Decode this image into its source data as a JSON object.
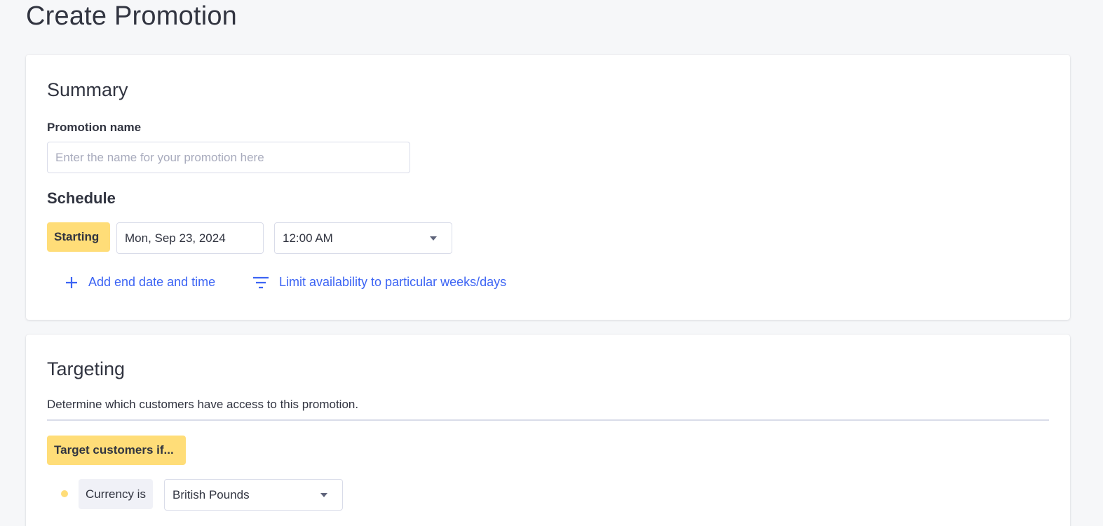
{
  "page": {
    "title": "Create Promotion"
  },
  "summary": {
    "title": "Summary",
    "promotion_name_label": "Promotion name",
    "promotion_name_value": "",
    "promotion_name_placeholder": "Enter the name for your promotion here",
    "schedule_title": "Schedule",
    "starting_label": "Starting",
    "start_date": "Mon, Sep 23, 2024",
    "start_time": "12:00 AM",
    "add_end_label": "Add end date and time",
    "limit_label": "Limit availability to particular weeks/days"
  },
  "targeting": {
    "title": "Targeting",
    "description": "Determine which customers have access to this promotion.",
    "target_label": "Target customers if...",
    "condition_label": "Currency is",
    "currency_value": "British Pounds"
  },
  "colors": {
    "accent_blue": "#3c64f4",
    "highlight_yellow": "#ffdd78",
    "text_dark": "#313440",
    "border": "#d9dce9"
  },
  "icons": {
    "add": "plus-icon",
    "limit": "filter-icon",
    "dropdown": "caret-down-icon"
  }
}
